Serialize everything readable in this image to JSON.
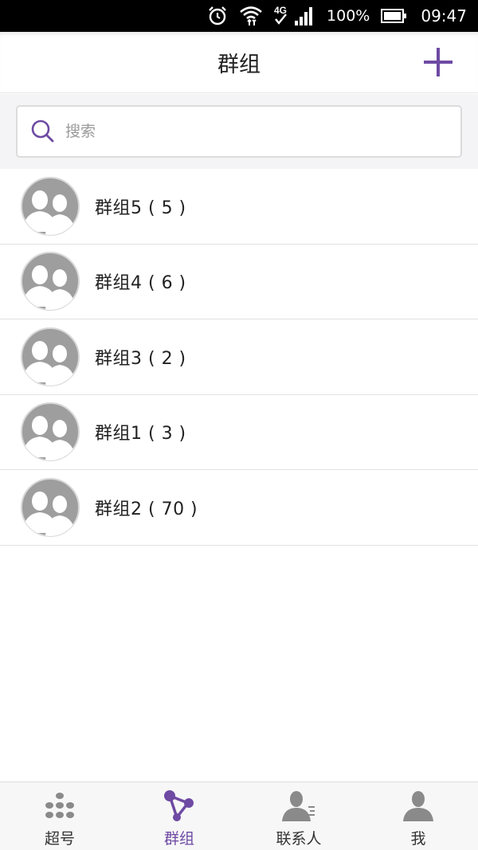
{
  "status_bar": {
    "network": "4G",
    "battery_percent": "100%",
    "time": "09:47"
  },
  "header": {
    "title": "群组",
    "add_icon": "plus-icon"
  },
  "search": {
    "placeholder": "搜索",
    "icon": "search-icon"
  },
  "groups": [
    {
      "name": "群组5 ( 5 )"
    },
    {
      "name": "群组4 ( 6 )"
    },
    {
      "name": "群组3 ( 2 )"
    },
    {
      "name": "群组1 ( 3 )"
    },
    {
      "name": "群组2 ( 70 )"
    }
  ],
  "tabs": [
    {
      "label": "超号",
      "icon": "dialpad-icon",
      "active": false
    },
    {
      "label": "群组",
      "icon": "group-network-icon",
      "active": true
    },
    {
      "label": "联系人",
      "icon": "contacts-icon",
      "active": false
    },
    {
      "label": "我",
      "icon": "person-icon",
      "active": false
    }
  ],
  "colors": {
    "accent": "#6e4aa3",
    "avatar_gray": "#9e9e9e",
    "tab_icon_gray": "#8a8a8a"
  }
}
